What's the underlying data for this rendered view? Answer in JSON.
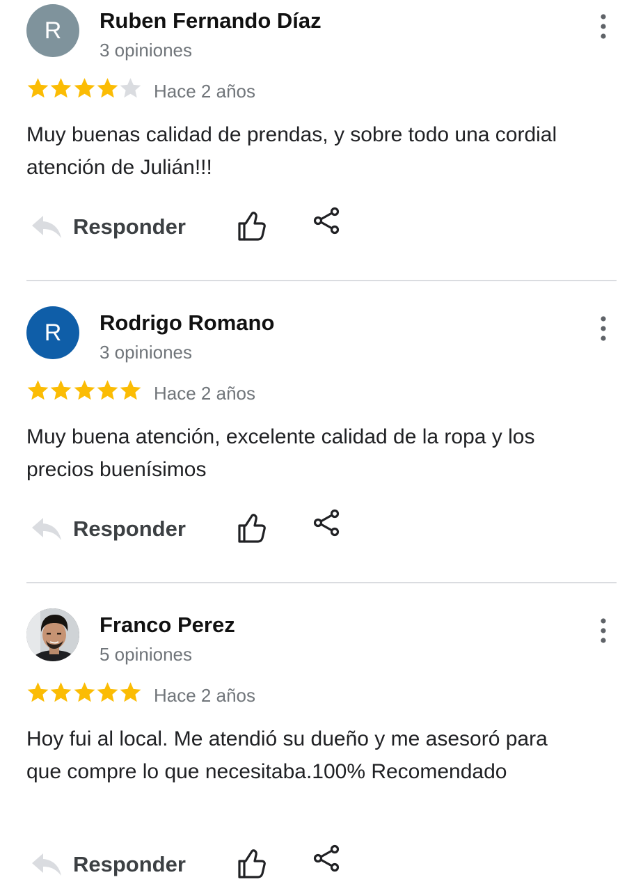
{
  "reviews": [
    {
      "avatar_letter": "R",
      "avatar_color": "#7f939c",
      "name": "Ruben Fernando Díaz",
      "count": "3 opiniones",
      "rating": 4,
      "date": "Hace 2 años",
      "text": "Muy buenas calidad de prendas, y sobre todo una cordial atención de Julián!!!",
      "reply_label": "Responder"
    },
    {
      "avatar_letter": "R",
      "avatar_color": "#0f5ea8",
      "name": "Rodrigo Romano",
      "count": "3 opiniones",
      "rating": 5,
      "date": "Hace 2 años",
      "text": "Muy buena atención, excelente calidad de la ropa y los precios buenísimos",
      "reply_label": "Responder"
    },
    {
      "avatar_letter": "",
      "avatar_color": "#3a3a3a",
      "name": "Franco Perez",
      "count": "5 opiniones",
      "rating": 5,
      "date": "Hace 2 años",
      "text": "Hoy fui al local. Me atendió su dueño y me asesoró para que compre lo que necesitaba.100% Recomendado",
      "reply_label": "Responder"
    }
  ],
  "colors": {
    "star_filled": "#fbbc04",
    "star_empty": "#dadce0"
  },
  "icons": [
    "more-vert-icon",
    "star-icon",
    "reply-icon",
    "thumb-up-icon",
    "share-icon",
    "avatar-photo"
  ]
}
